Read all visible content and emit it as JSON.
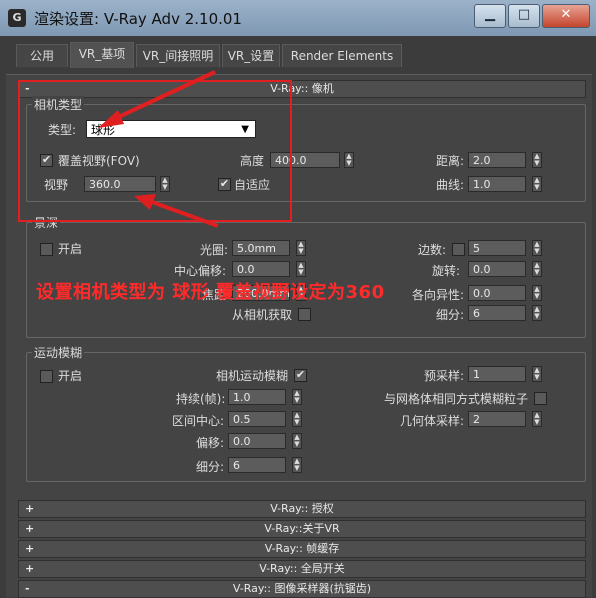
{
  "window": {
    "title": "渲染设置: V-Ray Adv 2.10.01",
    "icon_text": "G"
  },
  "tabs": [
    {
      "label": "公用",
      "active": false
    },
    {
      "label": "VR_基项",
      "active": true
    },
    {
      "label": "VR_间接照明",
      "active": false
    },
    {
      "label": "VR_设置",
      "active": false
    },
    {
      "label": "Render Elements",
      "active": false
    }
  ],
  "camera_rollout": {
    "title": "V-Ray:: 像机",
    "sign": "-",
    "camera_type_group": {
      "title": "相机类型",
      "type_label": "类型:",
      "type_value": "球形",
      "override_fov_label": "覆盖视野(FOV)",
      "override_fov_checked": "✔",
      "fov_label": "视野",
      "fov_value": "360.0",
      "height_label": "高度",
      "height_value": "400.0",
      "auto_fit_label": "自适应",
      "auto_fit_checked": "✔",
      "distance_label": "距离:",
      "distance_value": "2.0",
      "curve_label": "曲线:",
      "curve_value": "1.0"
    },
    "dof_group": {
      "title": "景深",
      "on_label": "开启",
      "aperture_label": "光圈:",
      "aperture_value": "5.0mm",
      "center_bias_label": "中心偏移:",
      "center_bias_value": "0.0",
      "focal_label": "焦距",
      "focal_value": "200.0mm",
      "get_from_camera_label": "从相机获取",
      "sides_label": "边数:",
      "sides_value": "5",
      "rotation_label": "旋转:",
      "rotation_value": "0.0",
      "anisotropy_label": "各向异性:",
      "anisotropy_value": "0.0",
      "subdivs_label": "细分:",
      "subdivs_value": "6"
    },
    "motion_blur_group": {
      "title": "运动模糊",
      "on_label": "开启",
      "camera_mb_label": "相机运动模糊",
      "camera_mb_checked": "✔",
      "duration_label": "持续(帧):",
      "duration_value": "1.0",
      "interval_center_label": "区间中心:",
      "interval_center_value": "0.5",
      "bias_label": "偏移:",
      "bias_value": "0.0",
      "subdivs_label": "细分:",
      "subdivs_value": "6",
      "prepass_label": "预采样:",
      "prepass_value": "1",
      "blur_particles_label": "与网格体相同方式模糊粒子",
      "geometry_samples_label": "几何体采样:",
      "geometry_samples_value": "2"
    }
  },
  "collapsed_rollouts": [
    {
      "title": "V-Ray:: 授权",
      "sign": "+"
    },
    {
      "title": "V-Ray::关于VR",
      "sign": "+"
    },
    {
      "title": "V-Ray:: 帧缓存",
      "sign": "+"
    },
    {
      "title": "V-Ray:: 全局开关",
      "sign": "+"
    },
    {
      "title": "V-Ray:: 图像采样器(抗锯齿)",
      "sign": "-"
    }
  ],
  "annotation": {
    "text": "设置相机类型为 球形 覆盖视野设定为360",
    "color": "#ff2a2a"
  }
}
